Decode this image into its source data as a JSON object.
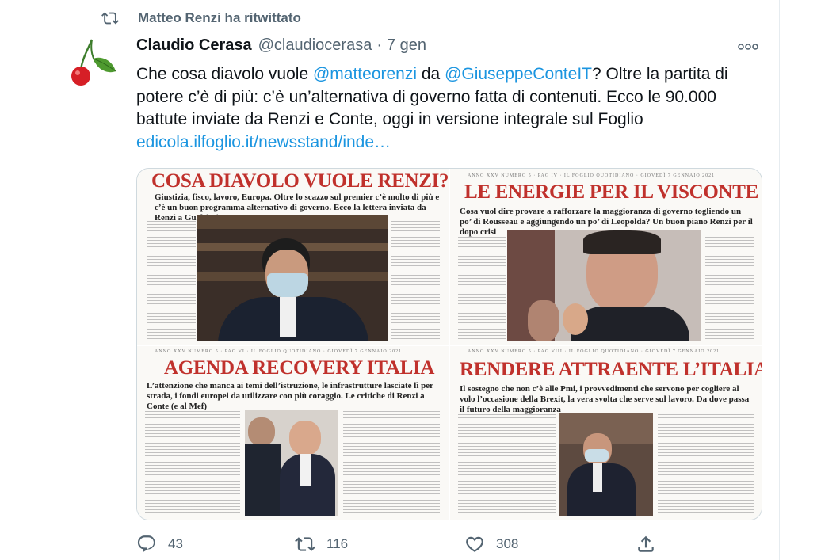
{
  "retweet": {
    "icon": "retweet-icon",
    "label": "Matteo Renzi ha ritwittato"
  },
  "tweet": {
    "author_name": "Claudio Cerasa",
    "handle": "@claudiocerasa",
    "separator": "·",
    "date": "7 gen",
    "text_parts": {
      "p1": "Che cosa diavolo vuole ",
      "mention1": "@matteorenzi",
      "p2": " da ",
      "mention2": "@GiuseppeConteIT",
      "p3": "? Oltre la partita di potere c’è di più: c’è un’alternativa di governo fatta di contenuti. Ecco le 90.000 battute inviate da Renzi e Conte, oggi in versione integrale sul Foglio ",
      "link": "edicola.ilfoglio.it/newsstand/inde…"
    }
  },
  "media": {
    "tl": {
      "headline": "COSA DIAVOLO VUOLE RENZI?",
      "subhead": "Giustizia, fisco, lavoro, Europa. Oltre lo scazzo sul premier c’è molto di più e c’è un buon programma alternativo di governo. Ecco la lettera inviata da Renzi a Gualtieri"
    },
    "tr": {
      "masthead": "ANNO XXV NUMERO 5 · PAG IV · IL FOGLIO QUOTIDIANO · GIOVEDÌ 7 GENNAIO 2021",
      "headline": "LE ENERGIE PER IL VISCONTE",
      "subhead": "Cosa vuol dire provare a rafforzare la maggioranza di governo togliendo un po’ di Rousseau e aggiungendo un po’ di Leopolda? Un buon piano Renzi per il dopo crisi"
    },
    "bl": {
      "masthead": "ANNO XXV NUMERO 5 · PAG VI · IL FOGLIO QUOTIDIANO · GIOVEDÌ 7 GENNAIO 2021",
      "headline": "AGENDA RECOVERY ITALIA",
      "subhead": "L’attenzione che manca ai temi dell’istruzione, le infrastrutture lasciate lì per strada, i fondi europei da utilizzare con più coraggio. Le critiche di Renzi a Conte (e al Mef)"
    },
    "br": {
      "masthead": "ANNO XXV NUMERO 5 · PAG VIII · IL FOGLIO QUOTIDIANO · GIOVEDÌ 7 GENNAIO 2021",
      "headline": "RENDERE ATTRAENTE L’ITALIA",
      "subhead": "Il sostegno che non c’è alle Pmi, i provvedimenti che servono per cogliere al volo l’occasione della Brexit, la vera svolta che serve sul lavoro. Da dove passa il futuro della maggioranza"
    }
  },
  "actions": {
    "reply": {
      "icon": "reply-icon",
      "count": "43"
    },
    "retweet": {
      "icon": "retweet-icon",
      "count": "116"
    },
    "like": {
      "icon": "like-icon",
      "count": "308"
    },
    "share": {
      "icon": "share-icon",
      "count": ""
    }
  },
  "colors": {
    "text_primary": "#0f1419",
    "text_secondary": "#536471",
    "link": "#1b95e0",
    "headline_red": "#c0312c"
  }
}
